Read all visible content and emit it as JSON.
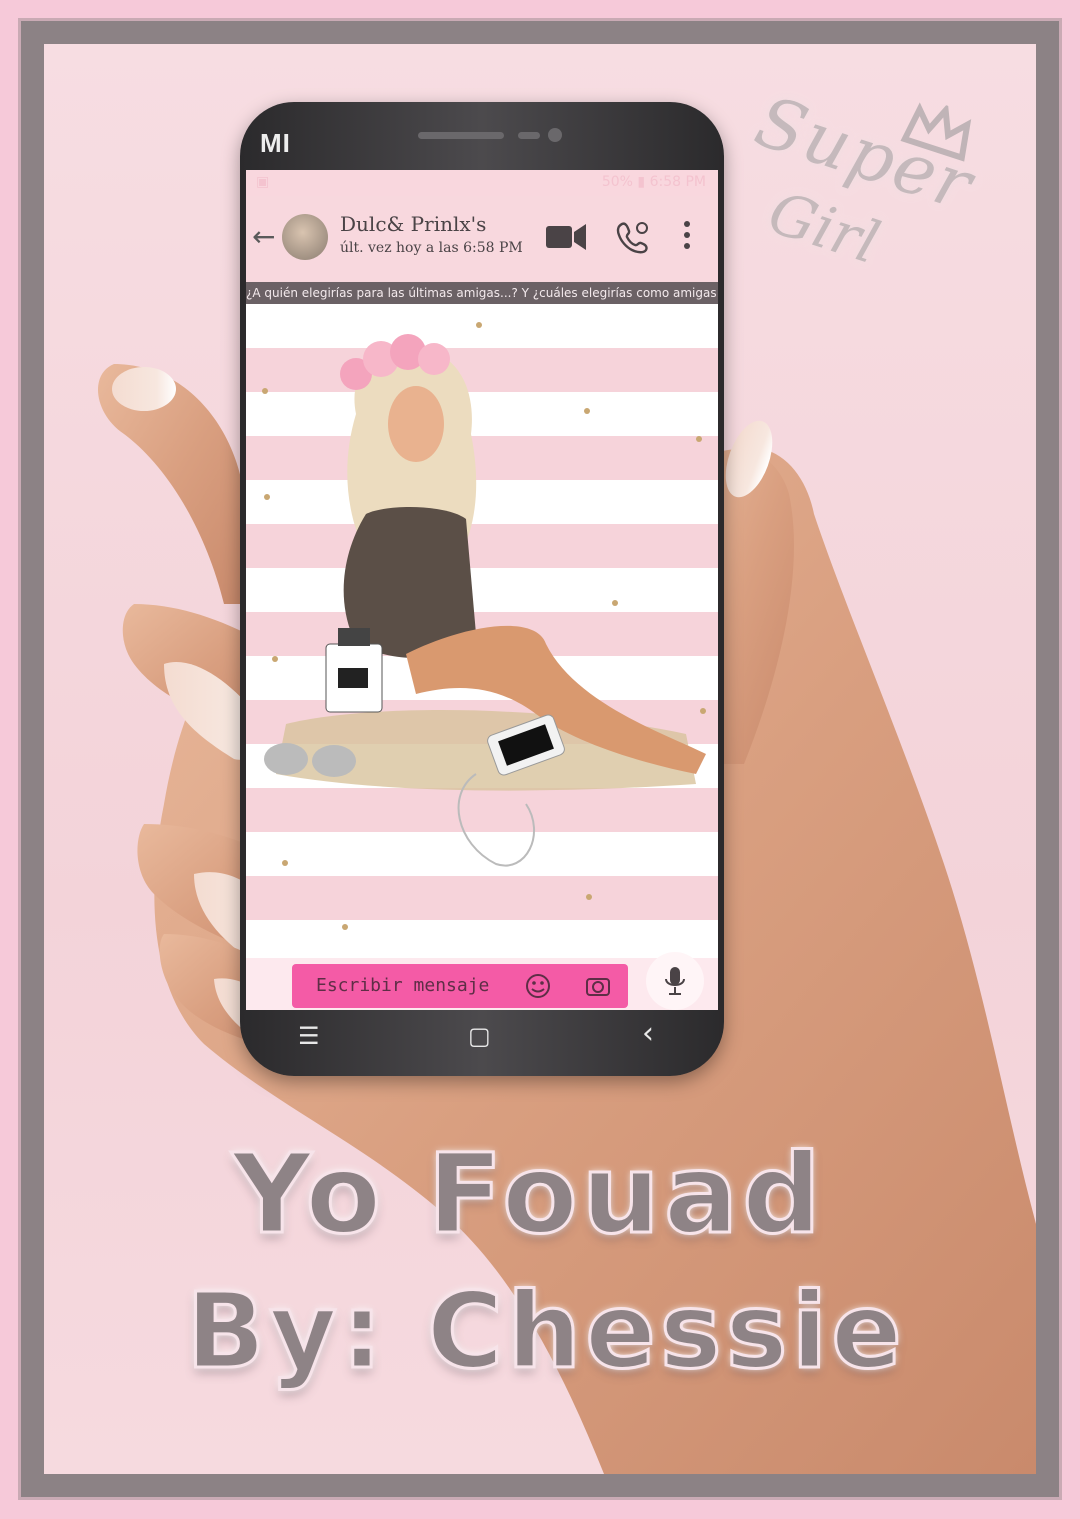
{
  "phone": {
    "brand": "MI",
    "status_left": "▣",
    "status_right": "50% ▮ 6:58 PM",
    "nav_menu": "☰",
    "nav_home": "▢",
    "nav_back": "‹"
  },
  "chat_header": {
    "back": "←",
    "contact_name": "Dulc& Prinlx's",
    "contact_status": "últ. vez hoy a las 6:58 PM",
    "video_call_icon": "video-camera-icon",
    "voice_call_icon": "phone-icon",
    "menu_icon": "kebab-icon"
  },
  "ticker": {
    "text": "¿A quién elegirías para las últimas amigas...? Y ¿cuáles elegirías como amigas de la vida?"
  },
  "composer": {
    "placeholder": "Escribir mensaje",
    "mic_icon": "microphone-icon"
  },
  "watermark": {
    "line1": "Super",
    "line2": "Girl"
  },
  "title": {
    "line1": "Yo Fouad",
    "line2": "By: Chessie"
  },
  "colors": {
    "frame": "#8c8285",
    "background": "#f3d3d9",
    "accent_pink": "#f45ba6",
    "stripe": "#f6d3da"
  }
}
